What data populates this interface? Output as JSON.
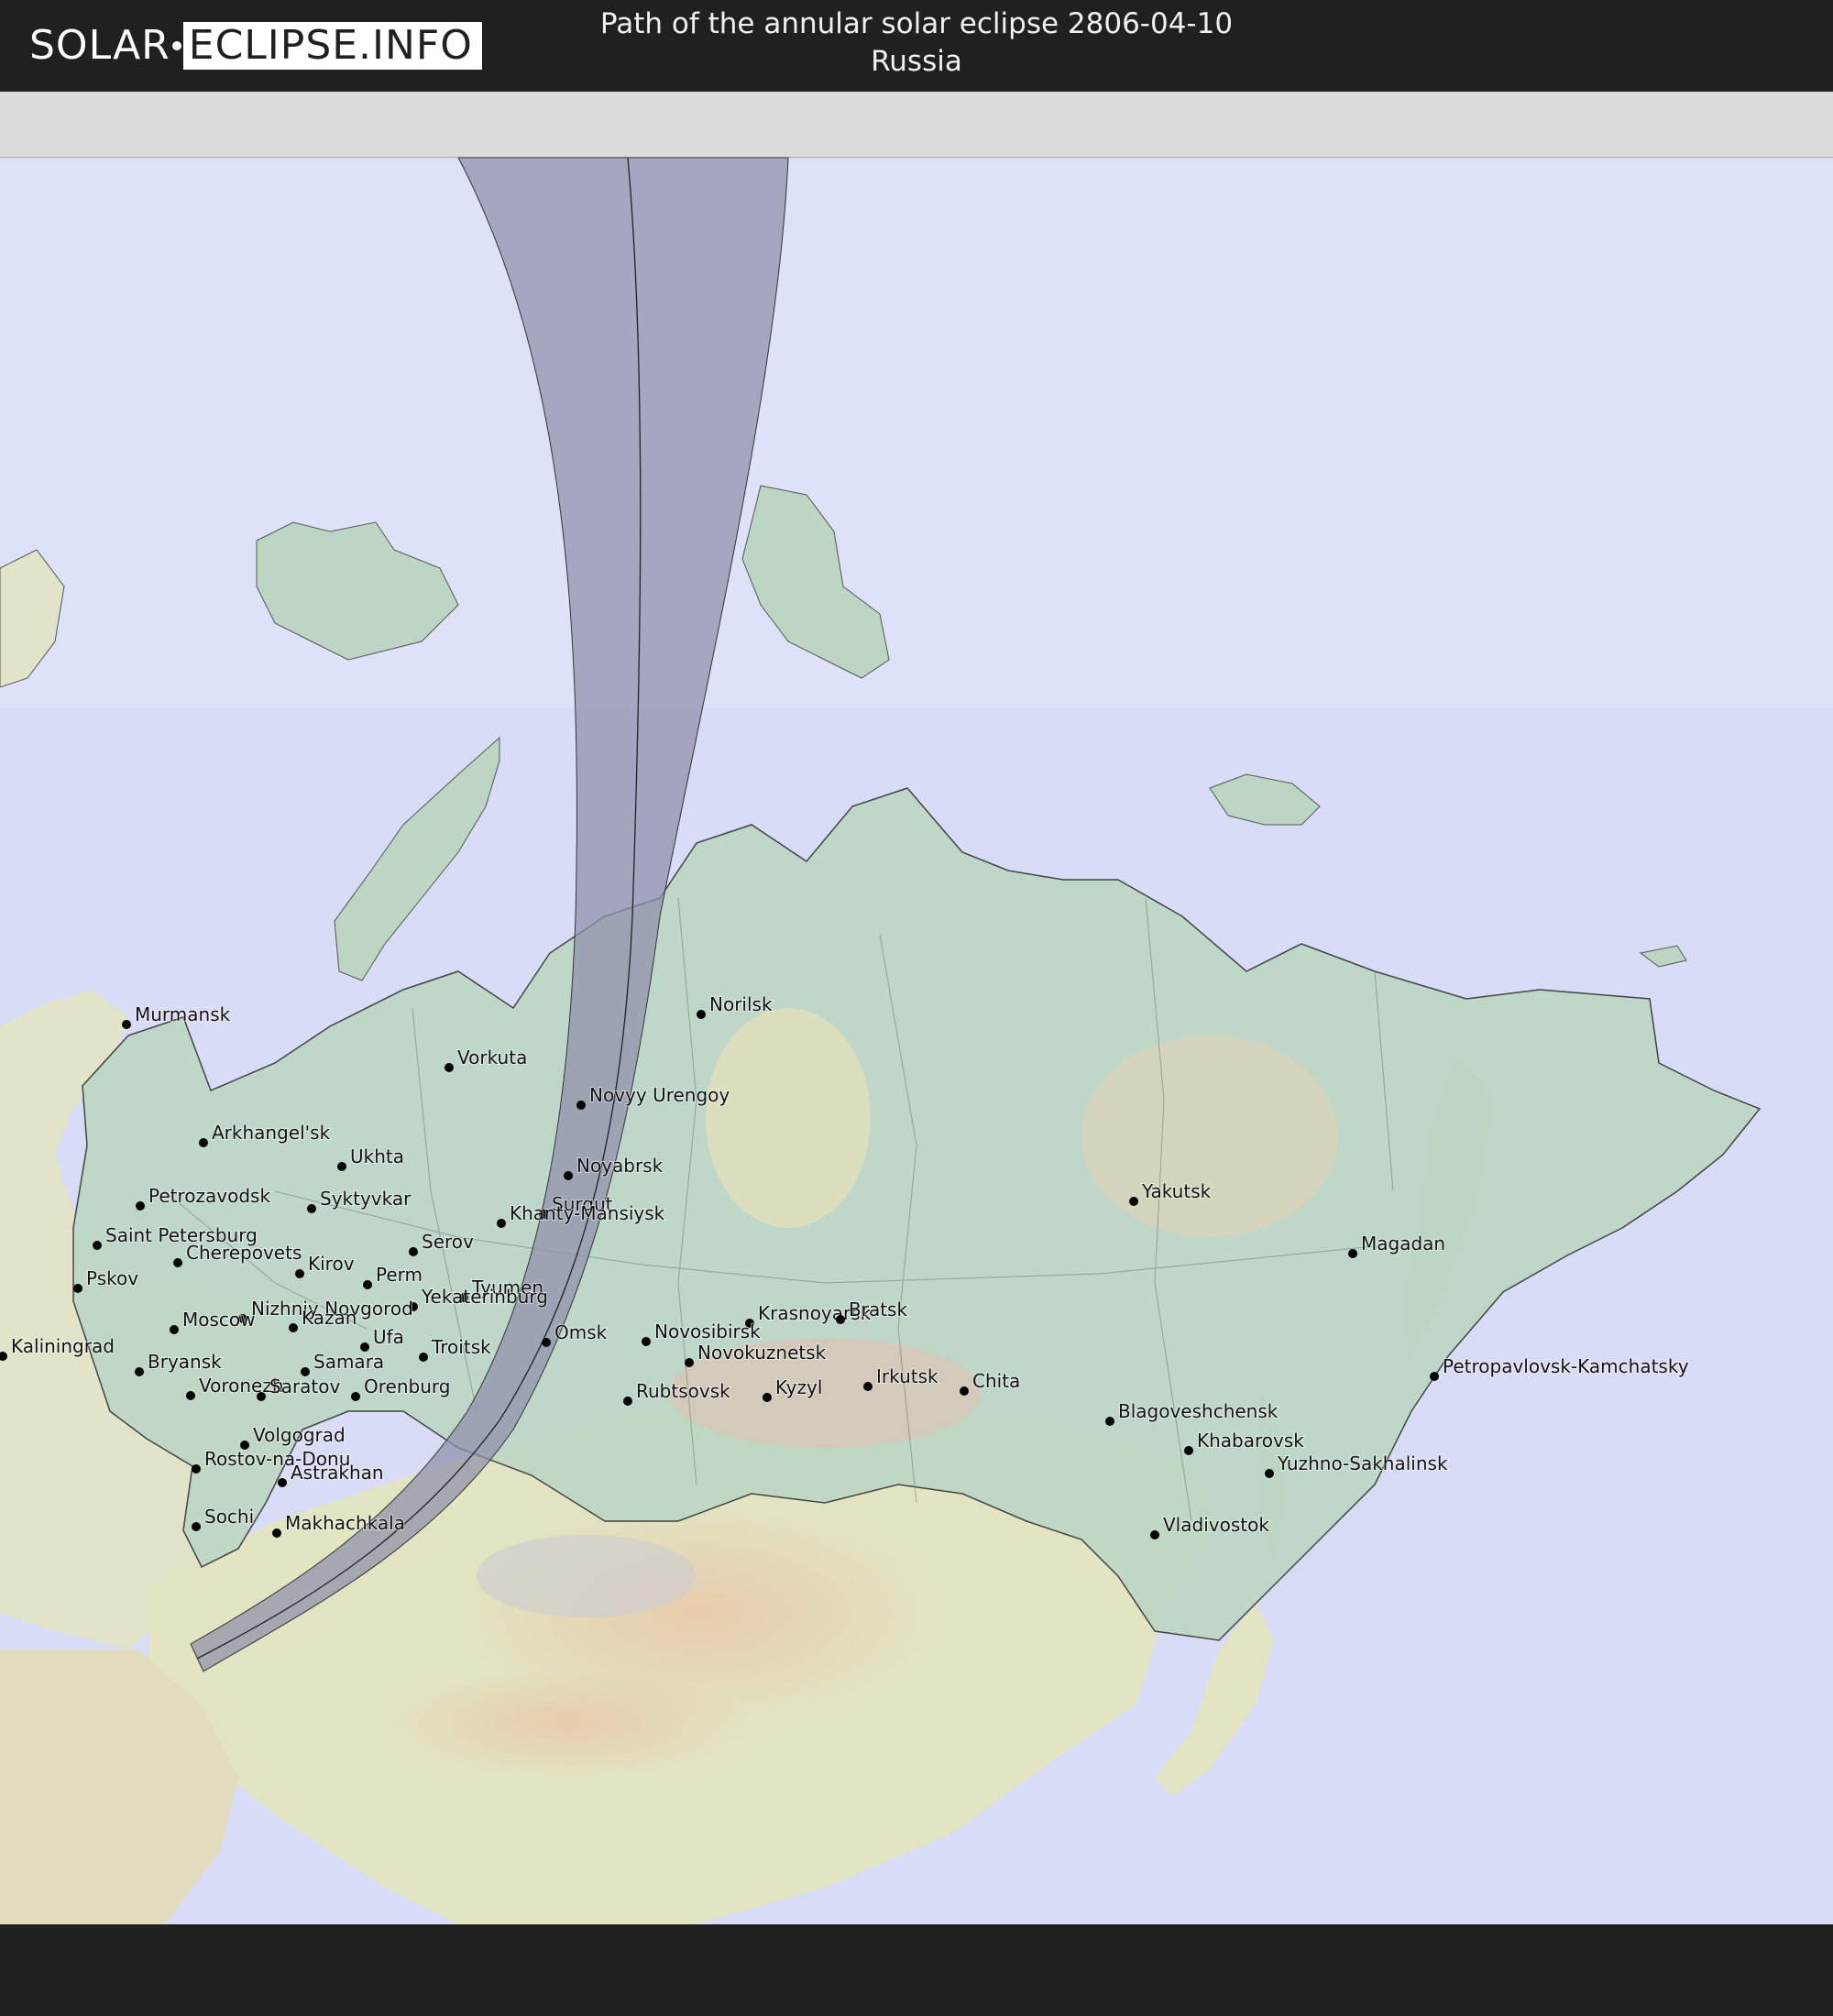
{
  "header": {
    "logo_left": "SOLAR",
    "logo_right": "ECLIPSE.INFO",
    "title_line1": "Path of the annular solar eclipse 2806-04-10",
    "title_line2": "Russia"
  },
  "colors": {
    "background": "#202020",
    "sea": "#d9ddf5",
    "land": "#dfe3c6",
    "russia": "#b9d3c0",
    "eclipse_band": "#8e8fa8",
    "text": "#111111"
  },
  "map": {
    "region": "Russia",
    "cities": [
      {
        "name": "Murmansk"
      },
      {
        "name": "Vorkuta"
      },
      {
        "name": "Norilsk"
      },
      {
        "name": "Novyy Urengoy"
      },
      {
        "name": "Arkhangel'sk"
      },
      {
        "name": "Ukhta"
      },
      {
        "name": "Noyabrsk"
      },
      {
        "name": "Petrozavodsk"
      },
      {
        "name": "Syktyvkar"
      },
      {
        "name": "Surgut"
      },
      {
        "name": "Khanty-Mansiysk"
      },
      {
        "name": "Yakutsk"
      },
      {
        "name": "Saint Petersburg"
      },
      {
        "name": "Cherepovets"
      },
      {
        "name": "Serov"
      },
      {
        "name": "Magadan"
      },
      {
        "name": "Pskov"
      },
      {
        "name": "Kirov"
      },
      {
        "name": "Perm"
      },
      {
        "name": "Tyumen"
      },
      {
        "name": "Yekaterinburg"
      },
      {
        "name": "Nizhniy Novgorod"
      },
      {
        "name": "Krasnoyarsk"
      },
      {
        "name": "Bratsk"
      },
      {
        "name": "Moscow"
      },
      {
        "name": "Kazan"
      },
      {
        "name": "Omsk"
      },
      {
        "name": "Novosibirsk"
      },
      {
        "name": "Kaliningrad"
      },
      {
        "name": "Ufa"
      },
      {
        "name": "Troitsk"
      },
      {
        "name": "Novokuznetsk"
      },
      {
        "name": "Petropavlovsk-Kamchatsky"
      },
      {
        "name": "Bryansk"
      },
      {
        "name": "Samara"
      },
      {
        "name": "Irkutsk"
      },
      {
        "name": "Chita"
      },
      {
        "name": "Voronezh"
      },
      {
        "name": "Saratov"
      },
      {
        "name": "Orenburg"
      },
      {
        "name": "Rubtsovsk"
      },
      {
        "name": "Kyzyl"
      },
      {
        "name": "Blagoveshchensk"
      },
      {
        "name": "Volgograd"
      },
      {
        "name": "Khabarovsk"
      },
      {
        "name": "Rostov-na-Donu"
      },
      {
        "name": "Yuzhno-Sakhalinsk"
      },
      {
        "name": "Astrakhan"
      },
      {
        "name": "Sochi"
      },
      {
        "name": "Makhachkala"
      },
      {
        "name": "Vladivostok"
      }
    ]
  }
}
